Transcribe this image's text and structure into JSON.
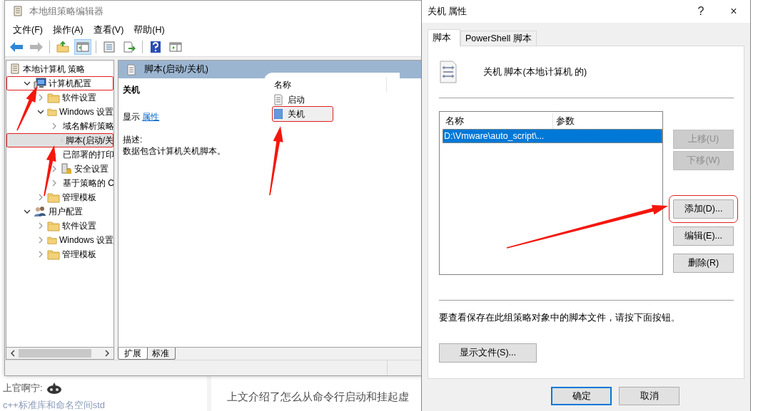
{
  "main_window": {
    "title": "本地组策略编辑器",
    "menu": [
      "文件(F)",
      "操作(A)",
      "查看(V)",
      "帮助(H)"
    ],
    "toolbar": [
      {
        "kind": "back",
        "disabled": false,
        "pressed": false
      },
      {
        "kind": "forward",
        "disabled": true,
        "pressed": false
      },
      {
        "kind": "separator"
      },
      {
        "kind": "up",
        "disabled": false,
        "pressed": false
      },
      {
        "kind": "tree",
        "disabled": false,
        "pressed": true
      },
      {
        "kind": "separator"
      },
      {
        "kind": "properties",
        "disabled": false,
        "pressed": false
      },
      {
        "kind": "export",
        "disabled": false,
        "pressed": false
      },
      {
        "kind": "separator"
      },
      {
        "kind": "help",
        "disabled": false,
        "pressed": false
      },
      {
        "kind": "view",
        "disabled": false,
        "pressed": false
      }
    ],
    "tree": [
      {
        "label": "本地计算机 策略",
        "kind": "policy",
        "selected": false,
        "marked": false,
        "children": [
          {
            "label": "计算机配置",
            "kind": "computer",
            "expanded": true,
            "selected": false,
            "marked": true,
            "children": [
              {
                "label": "软件设置",
                "kind": "folder",
                "expanded": false,
                "selected": false,
                "marked": false
              },
              {
                "label": "Windows 设置",
                "kind": "folder",
                "expanded": true,
                "selected": false,
                "marked": false,
                "children": [
                  {
                    "label": "域名解析策略",
                    "kind": "folder",
                    "expanded": false,
                    "selected": false,
                    "marked": false
                  },
                  {
                    "label": "脚本(启动/关",
                    "kind": "script",
                    "selected": true,
                    "marked": true
                  },
                  {
                    "label": "已部署的打印",
                    "kind": "printer",
                    "expanded": false,
                    "selected": false,
                    "marked": false
                  },
                  {
                    "label": "安全设置",
                    "kind": "security",
                    "expanded": false,
                    "selected": false,
                    "marked": false
                  },
                  {
                    "label": "基于策略的 C",
                    "kind": "chart",
                    "expanded": false,
                    "selected": false,
                    "marked": false
                  }
                ]
              },
              {
                "label": "管理模板",
                "kind": "folder",
                "expanded": false,
                "selected": false,
                "marked": false
              }
            ]
          },
          {
            "label": "用户配置",
            "kind": "user",
            "expanded": true,
            "selected": false,
            "marked": false,
            "children": [
              {
                "label": "软件设置",
                "kind": "folder",
                "expanded": false,
                "selected": false,
                "marked": false
              },
              {
                "label": "Windows 设置",
                "kind": "folder",
                "expanded": false,
                "selected": false,
                "marked": false
              },
              {
                "label": "管理模板",
                "kind": "folder",
                "expanded": false,
                "selected": false,
                "marked": false
              }
            ]
          }
        ]
      }
    ],
    "details": {
      "header": "脚本(启动/关机)",
      "heading": "关机",
      "show_label": "显示",
      "show_link": "属性",
      "description_label": "描述:",
      "description": "数据包含计算机关机脚本。"
    },
    "list": {
      "column": "名称",
      "items": [
        {
          "label": "启动",
          "kind": "script",
          "selected": false,
          "marked": false
        },
        {
          "label": "关机",
          "kind": "shutdown",
          "selected": true,
          "marked": true
        }
      ]
    },
    "view_tabs": [
      {
        "label": "扩展",
        "selected": true
      },
      {
        "label": "标准",
        "selected": false
      }
    ]
  },
  "dialog": {
    "title": "关机 属性",
    "help": "?",
    "close": "×",
    "tabs": [
      {
        "label": "脚本",
        "selected": true
      },
      {
        "label": "PowerShell 脚本",
        "selected": false
      }
    ],
    "heading": "关机 脚本(本地计算机 的)",
    "script_list": {
      "columns": [
        "名称",
        "参数"
      ],
      "rows": [
        {
          "name": "D:\\Vmware\\auto_script\\...",
          "selected": true
        }
      ]
    },
    "side_buttons": [
      {
        "label": "上移(U)",
        "disabled": true,
        "marked": false
      },
      {
        "label": "下移(W)",
        "disabled": true,
        "marked": false
      },
      {
        "label": "添加(D)...",
        "disabled": false,
        "marked": true
      },
      {
        "label": "编辑(E)...",
        "disabled": false,
        "marked": false
      },
      {
        "label": "删除(R)",
        "disabled": false,
        "marked": false
      }
    ],
    "hint": "要查看保存在此组策略对象中的脚本文件，请按下面按钮。",
    "show_files": "显示文件(S)...",
    "buttons": [
      {
        "label": "确定",
        "default": true
      },
      {
        "label": "取消",
        "default": false
      }
    ]
  },
  "background_page": {
    "comment_author": "上官啊宁:",
    "link": "c++标准库和命名空间std",
    "article_text": "上文介绍了怎么从命令行启动和挂起虚"
  }
}
